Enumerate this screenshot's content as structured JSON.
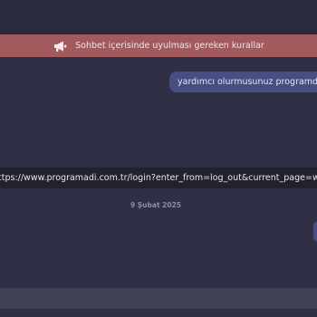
{
  "rules_banner": {
    "icon": "megaphone-icon",
    "text": "Sohbet içerisinde uyulması gereken kurallar"
  },
  "messages": [
    {
      "direction": "outgoing",
      "text": "yardımcı olurmusunuz programda işim var"
    },
    {
      "direction": "incoming",
      "text": "https://www.programadi.com.tr/login?enter_from=log_out&current_page=work_space"
    },
    {
      "direction": "outgoing",
      "text": ""
    }
  ],
  "date_separator": "9 Şubat 2025",
  "composer": {
    "value": "",
    "placeholder": ""
  },
  "colors": {
    "background": "#2f2f45",
    "banner": "#a35a5c",
    "outgoing_bubble": "#464e82",
    "incoming_bubble": "#22222f",
    "composer": "#414255"
  }
}
